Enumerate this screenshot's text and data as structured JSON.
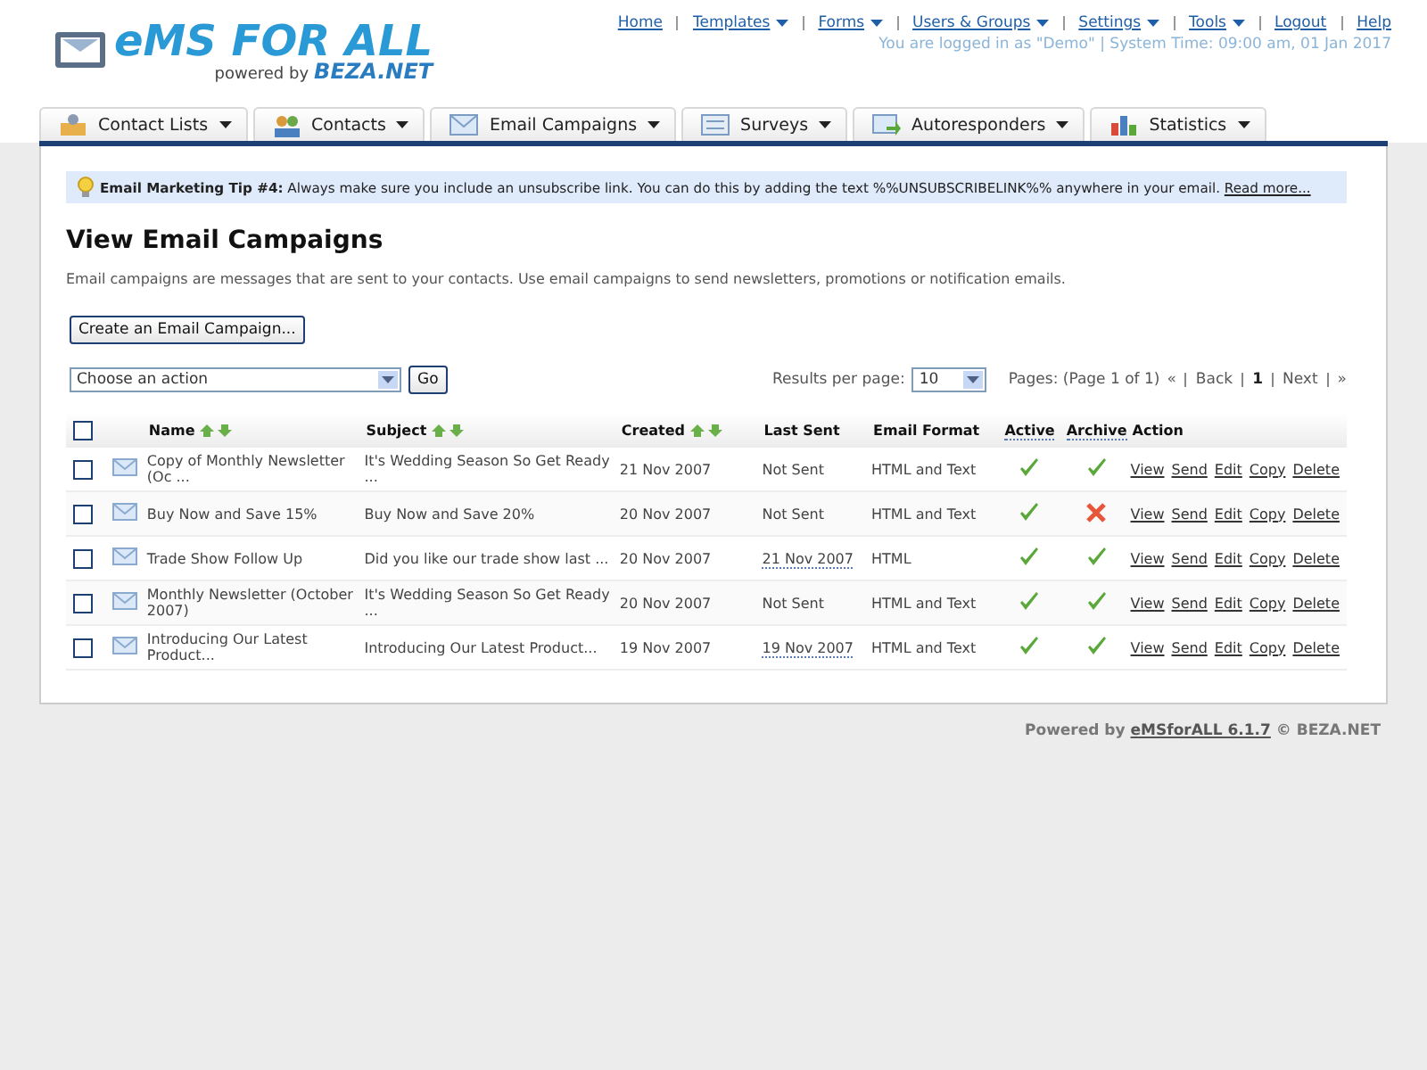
{
  "logo": {
    "title": "eMS FOR ALL",
    "powered_by": "powered by",
    "brand": "BEZA.NET"
  },
  "top_nav": [
    {
      "label": "Home",
      "dropdown": false
    },
    {
      "label": "Templates",
      "dropdown": true
    },
    {
      "label": "Forms",
      "dropdown": true
    },
    {
      "label": "Users & Groups",
      "dropdown": true
    },
    {
      "label": "Settings",
      "dropdown": true
    },
    {
      "label": "Tools",
      "dropdown": true
    },
    {
      "label": "Logout",
      "dropdown": false
    },
    {
      "label": "Help",
      "dropdown": false
    }
  ],
  "login_status": "You are logged in as \"Demo\" | System Time: 09:00 am, 01 Jan 2017",
  "tabs": [
    {
      "label": "Contact Lists"
    },
    {
      "label": "Contacts"
    },
    {
      "label": "Email Campaigns"
    },
    {
      "label": "Surveys"
    },
    {
      "label": "Autoresponders"
    },
    {
      "label": "Statistics"
    }
  ],
  "tip": {
    "label": "Email Marketing Tip #4:",
    "text": "Always make sure you include an unsubscribe link. You can do this by adding the text %%UNSUBSCRIBELINK%% anywhere in your email.",
    "link": "Read more..."
  },
  "heading": "View Email Campaigns",
  "description": "Email campaigns are messages that are sent to your contacts. Use email campaigns to send newsletters, promotions or notification emails.",
  "create_button": "Create an Email Campaign...",
  "action_select": {
    "value": "Choose an action"
  },
  "go_button": "Go",
  "results_per_page": {
    "label": "Results per page:",
    "value": "10"
  },
  "pagination": {
    "label": "Pages: (Page 1 of 1)",
    "first": "«",
    "back": "Back",
    "current": "1",
    "next": "Next",
    "last": "»"
  },
  "table": {
    "select_all": {
      "checked": false
    },
    "columns": [
      {
        "label": "Name",
        "sortable": true
      },
      {
        "label": "Subject",
        "sortable": true
      },
      {
        "label": "Created",
        "sortable": true
      },
      {
        "label": "Last Sent",
        "sortable": false
      },
      {
        "label": "Email Format",
        "sortable": false
      },
      {
        "label": "Active",
        "sortable": false
      },
      {
        "label": "Archive",
        "sortable": false
      },
      {
        "label": "Action",
        "sortable": false
      }
    ],
    "rows": [
      {
        "checked": false,
        "name": "Copy of Monthly Newsletter (Oc ...",
        "subject": "It's Wedding Season So Get Ready ...",
        "created": "21 Nov 2007",
        "last_sent": "Not Sent",
        "last_sent_link": false,
        "format": "HTML and Text",
        "active": true,
        "archive": true,
        "actions": [
          "View",
          "Send",
          "Edit",
          "Copy",
          "Delete"
        ]
      },
      {
        "checked": false,
        "name": "Buy Now and Save 15%",
        "subject": "Buy Now and Save 20%",
        "created": "20 Nov 2007",
        "last_sent": "Not Sent",
        "last_sent_link": false,
        "format": "HTML and Text",
        "active": true,
        "archive": false,
        "actions": [
          "View",
          "Send",
          "Edit",
          "Copy",
          "Delete"
        ]
      },
      {
        "checked": false,
        "name": "Trade Show Follow Up",
        "subject": "Did you like our trade show last ...",
        "created": "20 Nov 2007",
        "last_sent": "21 Nov 2007",
        "last_sent_link": true,
        "format": "HTML",
        "active": true,
        "archive": true,
        "actions": [
          "View",
          "Send",
          "Edit",
          "Copy",
          "Delete"
        ]
      },
      {
        "checked": false,
        "name": "Monthly Newsletter (October 2007)",
        "subject": "It's Wedding Season So Get Ready ...",
        "created": "20 Nov 2007",
        "last_sent": "Not Sent",
        "last_sent_link": false,
        "format": "HTML and Text",
        "active": true,
        "archive": true,
        "actions": [
          "View",
          "Send",
          "Edit",
          "Copy",
          "Delete"
        ]
      },
      {
        "checked": false,
        "name": "Introducing Our Latest Product...",
        "subject": "Introducing Our Latest Product...",
        "created": "19 Nov 2007",
        "last_sent": "19 Nov 2007",
        "last_sent_link": true,
        "format": "HTML and Text",
        "active": true,
        "archive": true,
        "actions": [
          "View",
          "Send",
          "Edit",
          "Copy",
          "Delete"
        ]
      }
    ]
  },
  "footer": {
    "prefix": "Powered by",
    "link": "eMSforALL 6.1.7",
    "suffix": "© BEZA.NET"
  }
}
